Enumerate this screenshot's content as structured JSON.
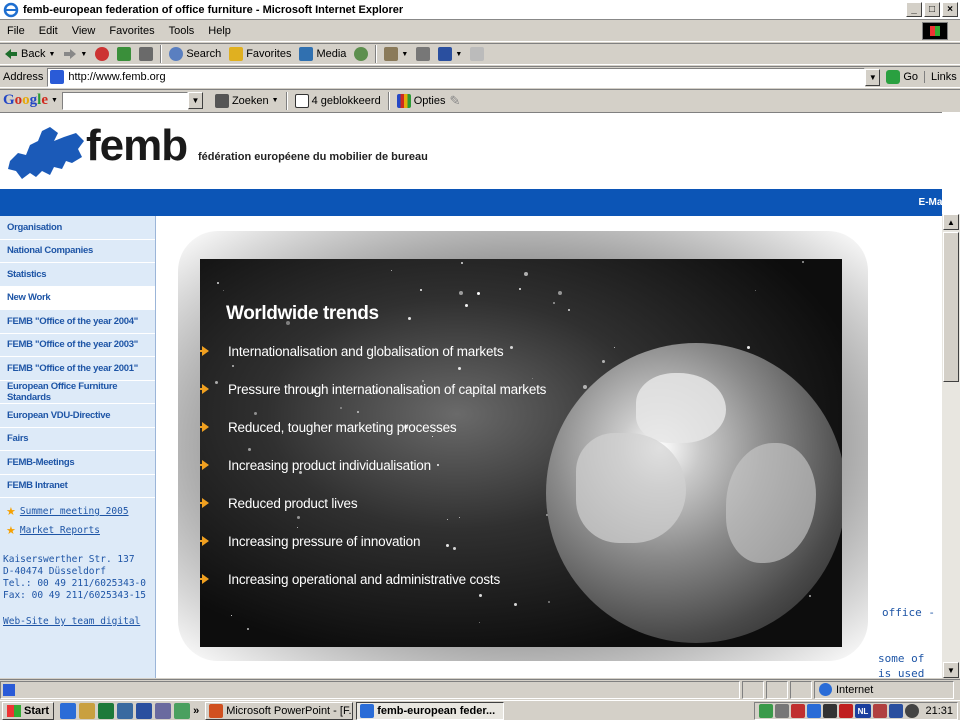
{
  "window": {
    "title": "femb-european federation of office furniture - Microsoft Internet Explorer"
  },
  "menu": [
    "File",
    "Edit",
    "View",
    "Favorites",
    "Tools",
    "Help"
  ],
  "toolbar": {
    "back": "Back",
    "search": "Search",
    "favorites": "Favorites",
    "media": "Media"
  },
  "address": {
    "label": "Address",
    "url": "http://www.femb.org",
    "go": "Go",
    "links": "Links"
  },
  "google_bar": {
    "logo": [
      "G",
      "o",
      "o",
      "g",
      "l",
      "e"
    ],
    "zoeken": "Zoeken",
    "blocked": "4 geblokkeerd",
    "options": "Opties"
  },
  "site": {
    "logo": "femb",
    "subtitle": "fédération européene du mobilier de bureau",
    "email": "E-Mail",
    "nav": [
      {
        "label": "Organisation",
        "active": false
      },
      {
        "label": "National Companies",
        "active": false
      },
      {
        "label": "Statistics",
        "active": false
      },
      {
        "label": "New Work",
        "active": true
      },
      {
        "label": "FEMB \"Office of the year 2004\"",
        "active": false
      },
      {
        "label": "FEMB \"Office of the year 2003\"",
        "active": false
      },
      {
        "label": "FEMB \"Office of the year 2001\"",
        "active": false
      },
      {
        "label": "European Office Furniture Standards",
        "active": false
      },
      {
        "label": "European VDU-Directive",
        "active": false
      },
      {
        "label": "Fairs",
        "active": false
      },
      {
        "label": "FEMB-Meetings",
        "active": false
      },
      {
        "label": "FEMB Intranet",
        "active": false
      }
    ],
    "side_links": [
      "Summer meeting 2005",
      "Market Reports"
    ],
    "address_lines": [
      "Kaiserswerther Str. 137",
      "D-40474 Düsseldorf",
      "Tel.: 00 49 211/6025343-0",
      "Fax: 00 49 211/6025343-15"
    ],
    "website_credit": "Web-Site by team digital",
    "right_fragments": [
      "office -",
      "some of",
      "is used"
    ]
  },
  "slide": {
    "title": "Worldwide trends",
    "bullets": [
      "Internationalisation and globalisation of markets",
      "Pressure through internationalisation of capital markets",
      "Reduced, tougher marketing processes",
      "Increasing product individualisation",
      "Reduced product lives",
      "Increasing pressure of innovation",
      "Increasing operational and administrative costs"
    ],
    "arrow_color": "#f0a020"
  },
  "status": {
    "zone": "Internet"
  },
  "taskbar": {
    "start": "Start",
    "tasks": [
      {
        "label": "Microsoft PowerPoint - [F...",
        "active": false
      },
      {
        "label": "femb-european feder...",
        "active": true
      }
    ],
    "tray_lang": "NL",
    "clock": "21:31"
  },
  "colors": {
    "site_blue": "#0c55b6",
    "nav_text": "#1e55a6",
    "sidebar_bg": "#ddeaf8"
  }
}
